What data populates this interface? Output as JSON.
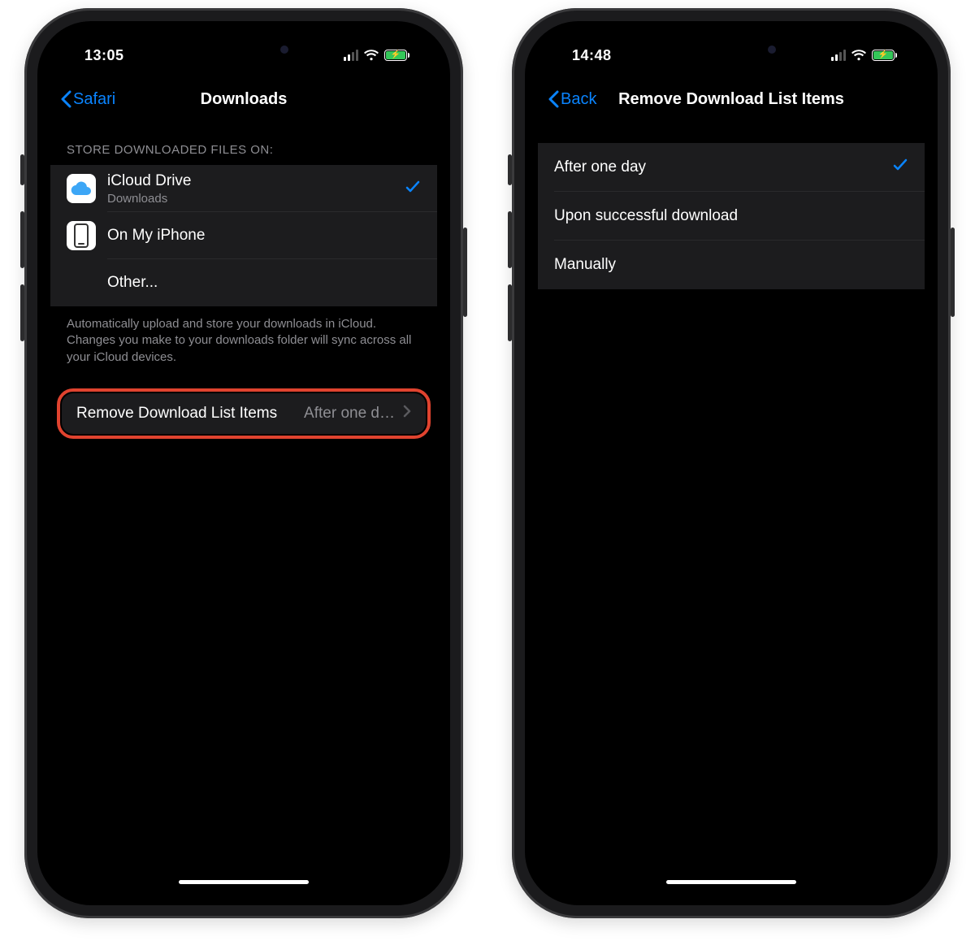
{
  "colors": {
    "accent": "#0a84ff",
    "highlight_border": "#e0432f",
    "battery_fill": "#34c759"
  },
  "phone1": {
    "status": {
      "time": "13:05"
    },
    "nav": {
      "back_label": "Safari",
      "title": "Downloads"
    },
    "section1": {
      "header": "Store downloaded files on:",
      "rows": [
        {
          "title": "iCloud Drive",
          "subtitle": "Downloads",
          "checked": true,
          "icon": "cloud"
        },
        {
          "title": "On My iPhone",
          "icon": "phone"
        },
        {
          "title": "Other..."
        }
      ],
      "footer": "Automatically upload and store your downloads in iCloud. Changes you make to your downloads folder will sync across all your iCloud devices."
    },
    "section2": {
      "row": {
        "label": "Remove Download List Items",
        "value": "After one d…"
      }
    }
  },
  "phone2": {
    "status": {
      "time": "14:48"
    },
    "nav": {
      "back_label": "Back",
      "title": "Remove Download List Items"
    },
    "options": [
      {
        "label": "After one day",
        "checked": true
      },
      {
        "label": "Upon successful download"
      },
      {
        "label": "Manually"
      }
    ]
  }
}
